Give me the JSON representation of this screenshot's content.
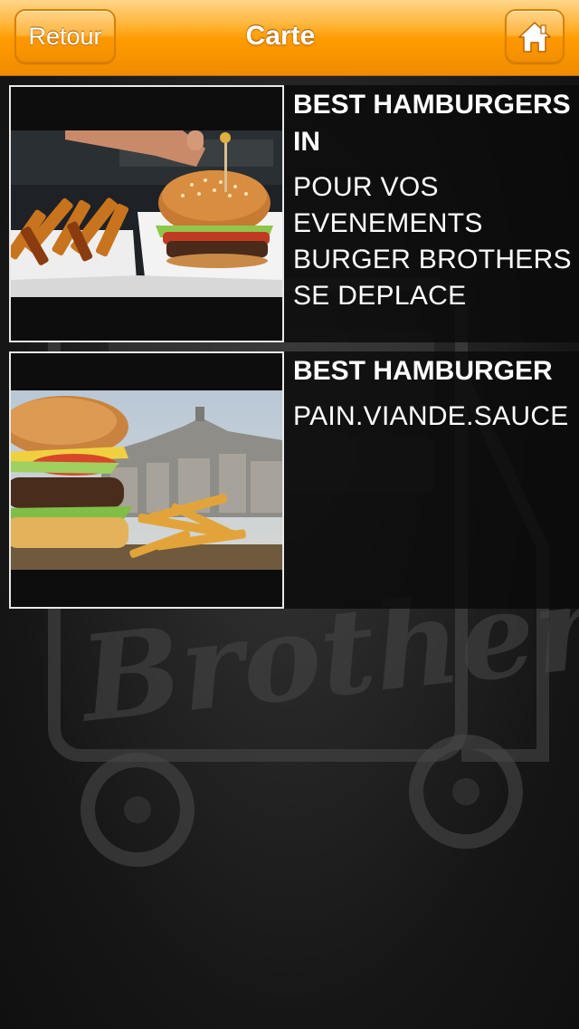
{
  "header": {
    "back_label": "Retour",
    "title": "Carte",
    "home_icon": "home-icon"
  },
  "items": [
    {
      "title": "BEST HAMBURGERS IN",
      "description": "POUR VOS EVENEMENTS BURGER BROTHERS SE DEPLACE",
      "image": "burger-and-fries-photo"
    },
    {
      "title": "BEST HAMBURGER",
      "description": "PAIN.VIANDE.SAUCE",
      "image": "burger-city-view-photo"
    }
  ],
  "background": {
    "watermark": "burger-brothers-truck-logo"
  },
  "colors": {
    "header_orange": "#ff9c00",
    "header_light": "#ffd68a",
    "row_background": "#0a0a0a",
    "text": "#ffffff"
  }
}
